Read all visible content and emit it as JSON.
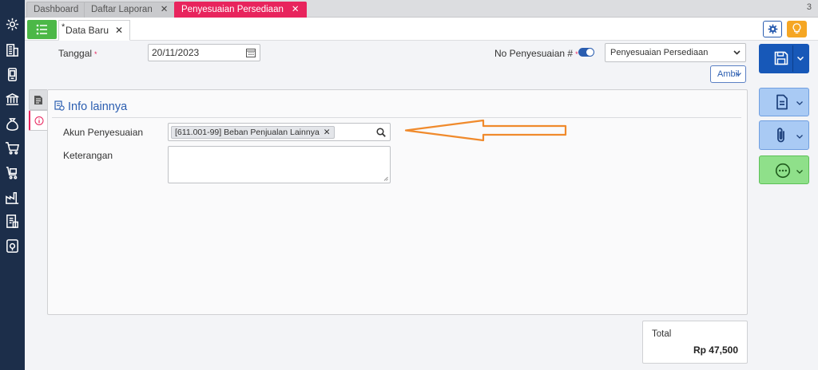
{
  "tabs": [
    {
      "label": "Dashboard",
      "closable": false
    },
    {
      "label": "Daftar Laporan",
      "closable": true
    },
    {
      "label": "Penyesuaian Persediaan",
      "closable": true,
      "active": true
    }
  ],
  "tab_count": "3",
  "data_tab": {
    "marker": "*",
    "label": "Data Baru"
  },
  "form": {
    "tanggal_label": "Tanggal",
    "tanggal_value": "20/11/2023",
    "required_mark": "*",
    "no_label": "No Penyesuaian #",
    "select_value": "Penyesuaian Persediaan",
    "ambil_label": "Ambil"
  },
  "panel": {
    "title": "Info lainnya",
    "akun_label": "Akun Penyesuaian",
    "akun_value": "[611.001-99] Beban Penjualan Lainnya",
    "keterangan_label": "Keterangan"
  },
  "total": {
    "label": "Total",
    "value": "Rp 47,500"
  },
  "colors": {
    "sidebar": "#1c2e4a",
    "active_tab": "#e8245d",
    "primary": "#1758b8",
    "success": "#4cb847",
    "warning": "#f5a623",
    "annotation_arrow": "#f08a2c"
  },
  "icons": {
    "sidebar": [
      "gear-icon",
      "building-icon",
      "device-icon",
      "bank-icon",
      "money-bag-icon",
      "cart-icon",
      "cart-box-icon",
      "factory-icon",
      "report-icon",
      "badge-icon"
    ],
    "toolbar": [
      "menu-list-icon",
      "gear-icon",
      "bulb-icon"
    ],
    "actions": [
      "save-icon",
      "document-icon",
      "paperclip-icon",
      "more-icon"
    ]
  }
}
